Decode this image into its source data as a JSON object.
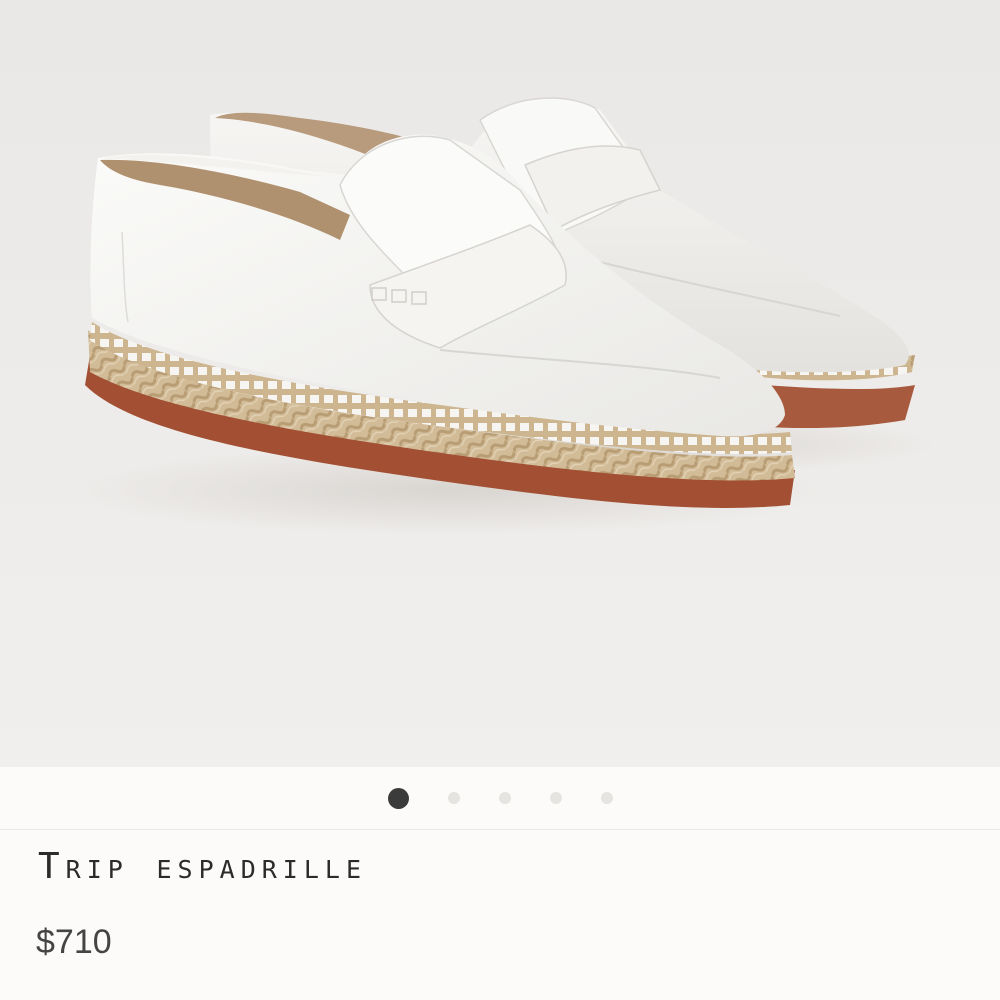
{
  "product": {
    "name": "Trip espadrille",
    "price": "$710"
  },
  "gallery": {
    "image_subject": "white-leather-espadrille-loafers",
    "slide_count": 5,
    "active_slide": 1,
    "dots": [
      {
        "active": true
      },
      {
        "active": false
      },
      {
        "active": false
      },
      {
        "active": false
      },
      {
        "active": false
      }
    ]
  },
  "colors": {
    "image_background": "#efedeb",
    "page_background": "#fcfbf9",
    "leather": "#f4f3f0",
    "jute": "#cdb58f",
    "sole": "#a24f33",
    "active_dot": "#3b3b3b",
    "inactive_dot": "#e6e4e1"
  }
}
